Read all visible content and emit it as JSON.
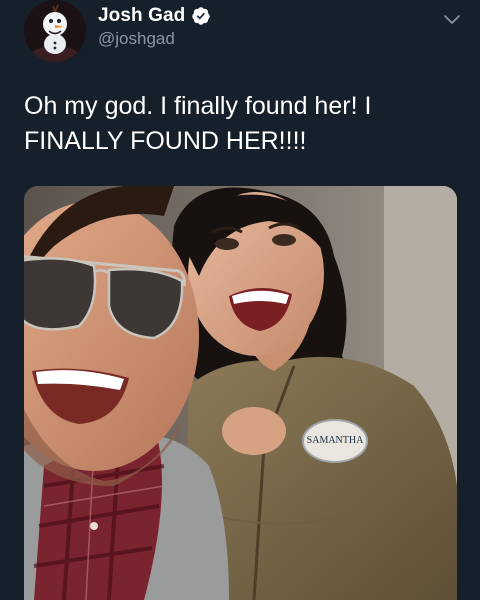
{
  "tweet": {
    "author": {
      "name": "Josh Gad",
      "handle": "@joshgad",
      "verified": true,
      "avatar_icon": "olaf-avatar"
    },
    "text": "Oh my god. I finally found her! I\nFINALLY FOUND HER!!!!",
    "media": {
      "type": "photo",
      "name_tag_text": "SAMANTHA"
    }
  },
  "colors": {
    "background": "#15202b",
    "name": "#ffffff",
    "handle": "#8899a6",
    "text": "#ffffff",
    "verified_badge": "#ffffff"
  }
}
